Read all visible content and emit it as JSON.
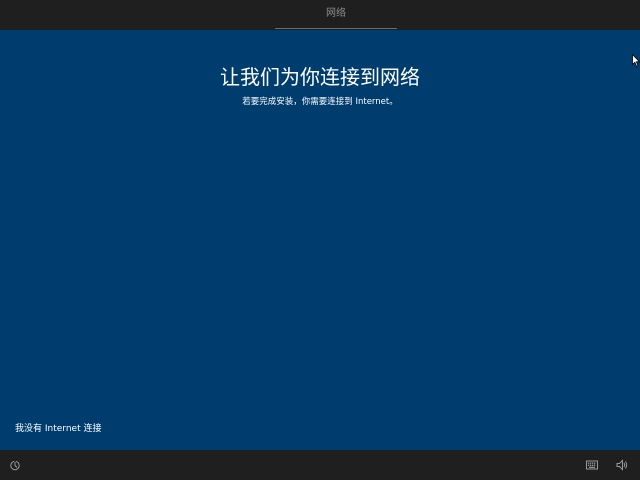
{
  "header": {
    "tab_label": "网络"
  },
  "main": {
    "title": "让我们为你连接到网络",
    "subtitle": "若要完成安装，你需要连接到 Internet。",
    "no_internet_link": "我没有 Internet 连接"
  },
  "footer": {
    "icons": [
      "ease-of-access-icon",
      "keyboard-icon",
      "volume-icon"
    ]
  },
  "colors": {
    "background": "#003d6f",
    "bar": "#1f1f1f",
    "text": "#ffffff",
    "tab_text": "#8c8c8c"
  }
}
